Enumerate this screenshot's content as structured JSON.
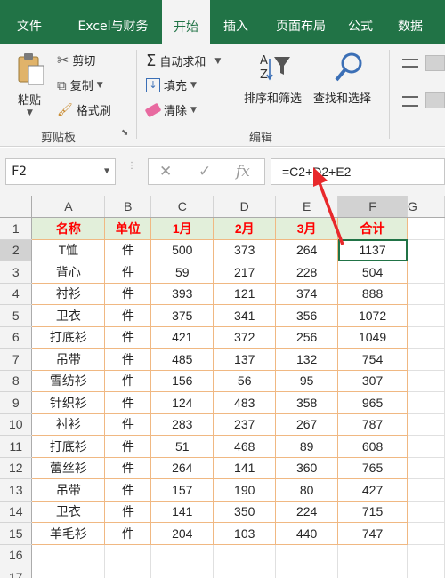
{
  "tabs": [
    {
      "label": "文件",
      "active": false
    },
    {
      "label": "Excel与财务",
      "active": false
    },
    {
      "label": "开始",
      "active": true
    },
    {
      "label": "插入",
      "active": false
    },
    {
      "label": "页面布局",
      "active": false
    },
    {
      "label": "公式",
      "active": false
    },
    {
      "label": "数据",
      "active": false
    }
  ],
  "ribbon": {
    "clipboard": {
      "paste": "粘贴",
      "cut": "剪切",
      "copy": "复制",
      "format_painter": "格式刷",
      "group_label": "剪贴板"
    },
    "editing": {
      "autosum": "自动求和",
      "fill": "填充",
      "clear": "清除",
      "sort_filter": "排序和筛选",
      "find_select": "查找和选择",
      "group_label": "编辑"
    }
  },
  "formula_bar": {
    "name_box": "F2",
    "formula": "=C2+D2+E2"
  },
  "sheet": {
    "columns": [
      "A",
      "B",
      "C",
      "D",
      "E",
      "F",
      "G"
    ],
    "selected_column": "F",
    "selected_row": 2,
    "header_row": [
      "名称",
      "单位",
      "1月",
      "2月",
      "3月",
      "合计"
    ],
    "rows": [
      [
        "T恤",
        "件",
        "500",
        "373",
        "264",
        "1137"
      ],
      [
        "背心",
        "件",
        "59",
        "217",
        "228",
        "504"
      ],
      [
        "衬衫",
        "件",
        "393",
        "121",
        "374",
        "888"
      ],
      [
        "卫衣",
        "件",
        "375",
        "341",
        "356",
        "1072"
      ],
      [
        "打底衫",
        "件",
        "421",
        "372",
        "256",
        "1049"
      ],
      [
        "吊带",
        "件",
        "485",
        "137",
        "132",
        "754"
      ],
      [
        "雪纺衫",
        "件",
        "156",
        "56",
        "95",
        "307"
      ],
      [
        "针织衫",
        "件",
        "124",
        "483",
        "358",
        "965"
      ],
      [
        "衬衫",
        "件",
        "283",
        "237",
        "267",
        "787"
      ],
      [
        "打底衫",
        "件",
        "51",
        "468",
        "89",
        "608"
      ],
      [
        "蕾丝衫",
        "件",
        "264",
        "141",
        "360",
        "765"
      ],
      [
        "吊带",
        "件",
        "157",
        "190",
        "80",
        "427"
      ],
      [
        "卫衣",
        "件",
        "141",
        "350",
        "224",
        "715"
      ],
      [
        "羊毛衫",
        "件",
        "204",
        "103",
        "440",
        "747"
      ]
    ],
    "row_numbers": [
      "1",
      "2",
      "3",
      "4",
      "5",
      "6",
      "7",
      "8",
      "9",
      "10",
      "11",
      "12",
      "13",
      "14",
      "15",
      "16",
      "17"
    ]
  },
  "colors": {
    "brand": "#217346",
    "header_fill": "#e2efda",
    "header_text": "#ff0000",
    "table_border": "#f0b882",
    "annotation_arrow": "#e8282b"
  }
}
